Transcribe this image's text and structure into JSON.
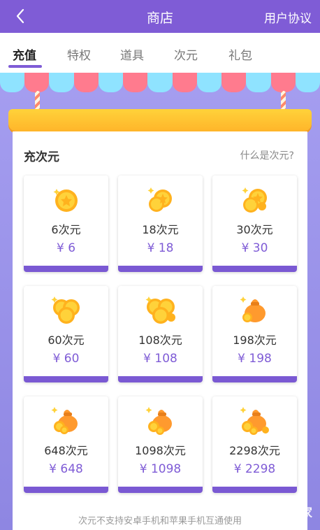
{
  "header": {
    "title": "商店",
    "agreement_label": "用户协议"
  },
  "tabs": [
    {
      "label": "充值",
      "active": true
    },
    {
      "label": "特权",
      "active": false
    },
    {
      "label": "道具",
      "active": false
    },
    {
      "label": "次元",
      "active": false
    },
    {
      "label": "礼包",
      "active": false
    }
  ],
  "section": {
    "title": "充次元",
    "help_label": "什么是次元?"
  },
  "packages": [
    {
      "amount": "6次元",
      "price": "¥ 6",
      "icon": "coin-icon"
    },
    {
      "amount": "18次元",
      "price": "¥ 18",
      "icon": "coins-icon"
    },
    {
      "amount": "30次元",
      "price": "¥ 30",
      "icon": "coins-icon"
    },
    {
      "amount": "60次元",
      "price": "¥ 60",
      "icon": "coin-stack-icon"
    },
    {
      "amount": "108次元",
      "price": "¥ 108",
      "icon": "coin-stack-icon"
    },
    {
      "amount": "198次元",
      "price": "¥ 198",
      "icon": "money-bag-icon"
    },
    {
      "amount": "648次元",
      "price": "¥ 648",
      "icon": "money-bag-icon"
    },
    {
      "amount": "1098次元",
      "price": "¥ 1098",
      "icon": "money-bag-icon"
    },
    {
      "amount": "2298次元",
      "price": "¥ 2298",
      "icon": "money-bag-icon"
    }
  ],
  "footer_note": "次元不支持安卓手机和苹果手机互通使用",
  "watermark": "系统之家",
  "colors": {
    "accent": "#7f5cd6",
    "background": "#8f86e3",
    "awning_red": "#ff7b8e",
    "awning_blue": "#8fe3ff",
    "shelf_gold": "#ffc22e"
  }
}
